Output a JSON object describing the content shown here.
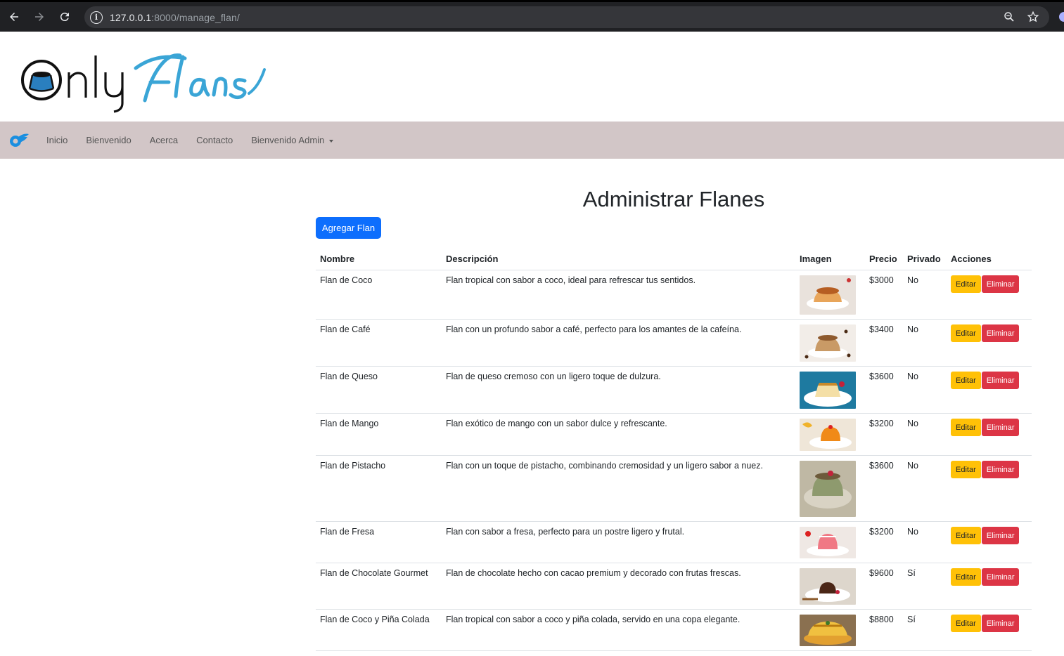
{
  "browser": {
    "url_host": "127.0.0.1",
    "url_rest": ":8000/manage_flan/"
  },
  "nav": {
    "items": [
      "Inicio",
      "Bienvenido",
      "Acerca",
      "Contacto"
    ],
    "dropdown_label": "Bienvenido Admin"
  },
  "main": {
    "title": "Administrar Flanes",
    "add_button": "Agregar Flan"
  },
  "table": {
    "headers": [
      "Nombre",
      "Descripción",
      "Imagen",
      "Precio",
      "Privado",
      "Acciones"
    ],
    "edit_label": "Editar",
    "delete_label": "Eliminar",
    "rows": [
      {
        "name": "Flan de Coco",
        "description": "Flan tropical con sabor a coco, ideal para refrescar tus sentidos.",
        "price": "$3000",
        "private": "No",
        "image": "coco"
      },
      {
        "name": "Flan de Café",
        "description": "Flan con un profundo sabor a café, perfecto para los amantes de la cafeína.",
        "price": "$3400",
        "private": "No",
        "image": "cafe"
      },
      {
        "name": "Flan de Queso",
        "description": "Flan de queso cremoso con un ligero toque de dulzura.",
        "price": "$3600",
        "private": "No",
        "image": "queso"
      },
      {
        "name": "Flan de Mango",
        "description": "Flan exótico de mango con un sabor dulce y refrescante.",
        "price": "$3200",
        "private": "No",
        "image": "mango"
      },
      {
        "name": "Flan de Pistacho",
        "description": "Flan con un toque de pistacho, combinando cremosidad y un ligero sabor a nuez.",
        "price": "$3600",
        "private": "No",
        "image": "pistacho"
      },
      {
        "name": "Flan de Fresa",
        "description": "Flan con sabor a fresa, perfecto para un postre ligero y frutal.",
        "price": "$3200",
        "private": "No",
        "image": "fresa"
      },
      {
        "name": "Flan de Chocolate Gourmet",
        "description": "Flan de chocolate hecho con cacao premium y decorado con frutas frescas.",
        "price": "$9600",
        "private": "Sí",
        "image": "chocolate"
      },
      {
        "name": "Flan de Coco y Piña Colada",
        "description": "Flan tropical con sabor a coco y piña colada, servido en una copa elegante.",
        "price": "$8800",
        "private": "Sí",
        "image": "pina"
      }
    ]
  }
}
